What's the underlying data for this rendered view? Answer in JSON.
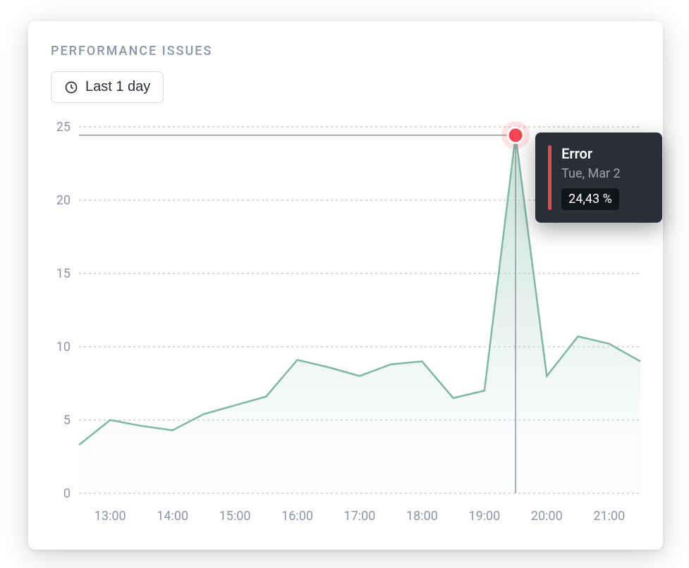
{
  "header": {
    "title": "PERFORMANCE ISSUES",
    "time_range_label": "Last 1 day"
  },
  "tooltip": {
    "title": "Error",
    "date": "Tue, Mar 2",
    "value": "24,43 %"
  },
  "chart_data": {
    "type": "area",
    "title": "",
    "xlabel": "",
    "ylabel": "",
    "ylim": [
      0,
      25
    ],
    "y_ticks": [
      0,
      5,
      10,
      15,
      20,
      25
    ],
    "x_ticks": [
      "13:00",
      "14:00",
      "15:00",
      "16:00",
      "17:00",
      "18:00",
      "19:00",
      "20:00",
      "21:00"
    ],
    "categories": [
      "12:30",
      "13:00",
      "13:30",
      "14:00",
      "14:30",
      "15:00",
      "15:30",
      "16:00",
      "16:30",
      "17:00",
      "17:30",
      "18:00",
      "18:30",
      "19:00",
      "19:30",
      "20:00",
      "20:30",
      "21:00",
      "21:30"
    ],
    "series": [
      {
        "name": "Error",
        "values": [
          3.3,
          5.0,
          4.6,
          4.3,
          5.4,
          6.0,
          6.6,
          9.1,
          8.6,
          8.0,
          8.8,
          9.0,
          6.5,
          7.0,
          24.43,
          8.0,
          10.7,
          10.2,
          9.0
        ]
      }
    ],
    "highlight": {
      "x": "19:30",
      "y": 24.43
    }
  }
}
